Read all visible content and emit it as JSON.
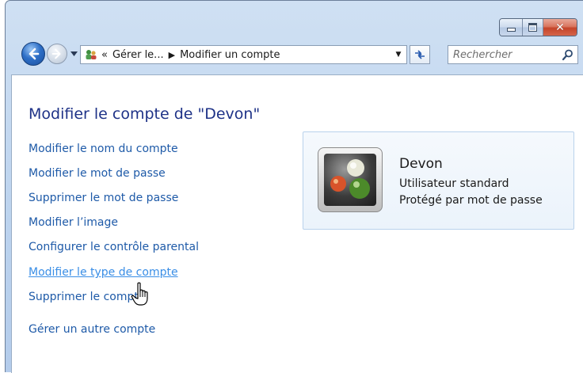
{
  "address_bar": {
    "crumbs": [
      "Gérer le...",
      "Modifier un compte"
    ],
    "overflow": "«"
  },
  "search": {
    "placeholder": "Rechercher"
  },
  "page": {
    "title": "Modifier le compte de \"Devon\""
  },
  "tasks": [
    {
      "label": "Modifier le nom du compte",
      "state": "normal"
    },
    {
      "label": "Modifier le mot de passe",
      "state": "normal"
    },
    {
      "label": "Supprimer le mot de passe",
      "state": "normal"
    },
    {
      "label": "Modifier l’image",
      "state": "normal"
    },
    {
      "label": "Configurer le contrôle parental",
      "state": "normal"
    },
    {
      "label": "Modifier le type de compte",
      "state": "hover"
    },
    {
      "label": "Supprimer le compte",
      "state": "normal"
    },
    {
      "label": "Gérer un autre compte",
      "state": "normal"
    }
  ],
  "account": {
    "name": "Devon",
    "type": "Utilisateur standard",
    "status": "Protégé par mot de passe"
  },
  "colors": {
    "link": "#1e5aa8",
    "link_hover": "#3a8ee6",
    "title": "#1e3287"
  },
  "icons": [
    "back-arrow-icon",
    "forward-arrow-icon",
    "users-icon",
    "refresh-icon",
    "search-icon",
    "hand-cursor-icon"
  ]
}
